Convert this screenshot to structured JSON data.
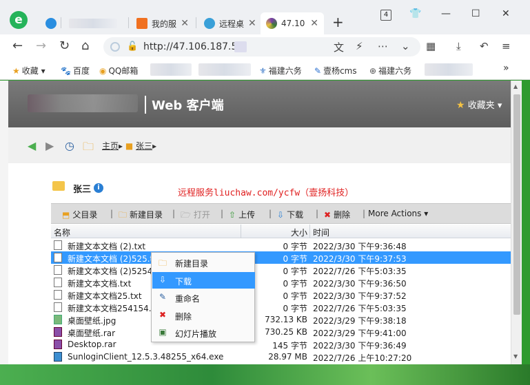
{
  "browser": {
    "tabs": [
      {
        "label": "",
        "blurred": true
      },
      {
        "label": "我的服",
        "favicon_color": "#f07020"
      },
      {
        "label": "远程桌",
        "favicon_color": "#3aa0d8"
      },
      {
        "label": "47.10",
        "favicon_color": "#7a3fa8",
        "active": true
      }
    ],
    "tab_count": "4",
    "url": "http://47.106.187.5",
    "bookmarks": [
      {
        "label": "收藏",
        "icon": "star-icon"
      },
      {
        "label": "百度",
        "icon": "baidu-paw-icon"
      },
      {
        "label": "QQ邮箱",
        "icon": "qq-mail-icon"
      },
      {
        "label": "福建六务",
        "icon": "bookmark-icon"
      },
      {
        "label": "壹杨cms",
        "icon": "bookmark-icon"
      },
      {
        "label": "福建六务",
        "icon": "globe-icon"
      }
    ],
    "bookmarks_more": "»"
  },
  "page": {
    "app_title": "Web 客户端",
    "favorites_label": "收藏夹",
    "breadcrumb": {
      "home": "主页",
      "folder": "张三"
    },
    "folder_title": "张三",
    "promo": "远程服务liuchaw.com/ycfw（壹扬科技）",
    "toolbar": {
      "parent": "父目录",
      "new_folder": "新建目录",
      "open": "打开",
      "upload": "上传",
      "download": "下载",
      "delete": "删除",
      "more": "More Actions"
    },
    "columns": {
      "name": "名称",
      "size": "大小",
      "time": "时间"
    },
    "files": [
      {
        "name": "新建文本文档 (2).txt",
        "size": "0 字节",
        "time": "2022/3/30 下午9:36:48",
        "type": "txt"
      },
      {
        "name": "新建文本文档 (2)525.txt",
        "size": "0 字节",
        "time": "2022/3/30 下午9:37:53",
        "type": "txt",
        "selected": true
      },
      {
        "name": "新建文本文档 (2)52545.txt",
        "size": "0 字节",
        "time": "2022/7/26 下午5:03:35",
        "type": "txt"
      },
      {
        "name": "新建文本文档.txt",
        "size": "0 字节",
        "time": "2022/3/30 下午9:36:50",
        "type": "txt"
      },
      {
        "name": "新建文本文档25.txt",
        "size": "0 字节",
        "time": "2022/3/30 下午9:37:52",
        "type": "txt"
      },
      {
        "name": "新建文本文档254154.txt",
        "size": "0 字节",
        "time": "2022/7/26 下午5:03:35",
        "type": "txt"
      },
      {
        "name": "桌面壁纸.jpg",
        "size": "732.13 KB",
        "time": "2022/3/29 下午9:38:18",
        "type": "img"
      },
      {
        "name": "桌面壁纸.rar",
        "size": "730.25 KB",
        "time": "2022/3/29 下午9:41:00",
        "type": "rar"
      },
      {
        "name": "Desktop.rar",
        "size": "145 字节",
        "time": "2022/3/30 下午9:36:49",
        "type": "rar"
      },
      {
        "name": "SunloginClient_12.5.3.48255_x64.exe",
        "size": "28.97 MB",
        "time": "2022/7/26 上午10:27:20",
        "type": "exe"
      }
    ],
    "context_menu": [
      {
        "label": "新建目录",
        "icon": "new-folder-icon"
      },
      {
        "label": "下载",
        "icon": "download-icon",
        "selected": true
      },
      {
        "label": "重命名",
        "icon": "rename-icon"
      },
      {
        "label": "删除",
        "icon": "delete-icon"
      },
      {
        "label": "幻灯片播放",
        "icon": "slideshow-icon"
      }
    ]
  }
}
